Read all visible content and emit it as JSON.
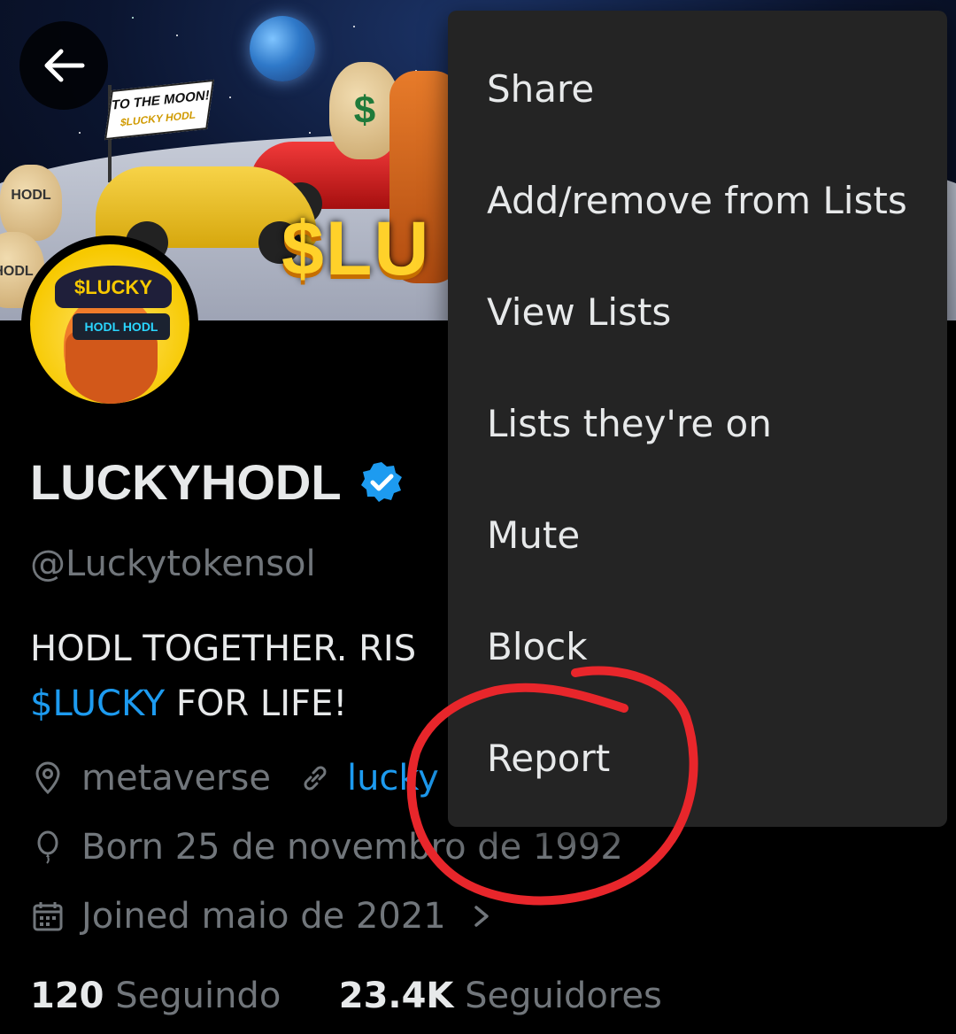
{
  "banner": {
    "flag_line1": "TO THE MOON!",
    "flag_line2": "$LUCKY HODL",
    "bag_label": "HODL",
    "bag_dollar": "$",
    "ticker_partial": "$LU"
  },
  "avatar": {
    "cap_text": "$LUCKY",
    "glasses_text": "HODL HODL"
  },
  "profile": {
    "display_name": "LUCKYHODL",
    "handle": "@Luckytokensol",
    "bio_line1": "HODL TOGETHER. RIS",
    "bio_tag": "$LUCKY",
    "bio_line2_rest": " FOR LIFE!",
    "location": "metaverse",
    "website_partial": "lucky",
    "born": "Born 25 de novembro de 1992",
    "joined": "Joined maio de 2021",
    "following_count": "120",
    "following_label": "Seguindo",
    "followers_count": "23.4K",
    "followers_label": "Seguidores"
  },
  "menu": {
    "items": [
      {
        "label": "Share"
      },
      {
        "label": "Add/remove from Lists"
      },
      {
        "label": "View Lists"
      },
      {
        "label": "Lists they're on"
      },
      {
        "label": "Mute"
      },
      {
        "label": "Block"
      },
      {
        "label": "Report"
      }
    ]
  },
  "colors": {
    "background": "#000000",
    "menu_bg": "#242424",
    "text_primary": "#e7e9ea",
    "text_secondary": "#71767b",
    "link": "#1d9bf0",
    "annotation": "#e8262b"
  }
}
